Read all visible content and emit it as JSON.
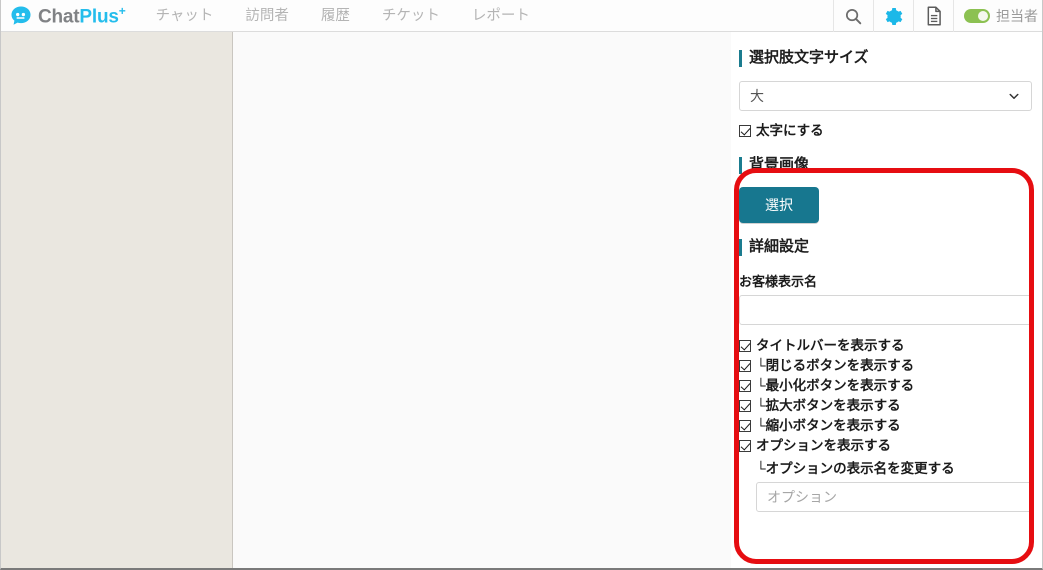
{
  "header": {
    "logo": {
      "icon": "chat-bubble-icon",
      "text_primary": "Chat",
      "text_secondary": "Plus",
      "superscript": "+"
    },
    "nav_items": [
      {
        "label": "チャット",
        "name": "nav-chat"
      },
      {
        "label": "訪問者",
        "name": "nav-visitors"
      },
      {
        "label": "履歴",
        "name": "nav-history"
      },
      {
        "label": "チケット",
        "name": "nav-tickets"
      },
      {
        "label": "レポート",
        "name": "nav-reports"
      }
    ],
    "actions": [
      {
        "icon": "search-icon",
        "name": "search-button"
      },
      {
        "icon": "gear-icon",
        "name": "settings-button"
      },
      {
        "icon": "document-icon",
        "name": "document-button"
      }
    ],
    "toggle": {
      "label": "担当者",
      "state": "on",
      "on_color": "#8cc152"
    }
  },
  "settings": {
    "font_size_section": {
      "title": "選択肢文字サイズ",
      "select_value": "大",
      "select_options": [
        "大"
      ],
      "bold_checkbox": {
        "label": "太字にする",
        "checked": true
      }
    },
    "background_section": {
      "title": "背景画像",
      "select_button_label": "選択"
    },
    "detail_section": {
      "title": "詳細設定",
      "display_name_label": "お客様表示名",
      "display_name_value": "",
      "display_name_placeholder": "",
      "checkboxes": [
        {
          "label": "タイトルバーを表示する",
          "checked": true,
          "name": "checkbox-show-titlebar"
        },
        {
          "label": "└閉じるボタンを表示する",
          "checked": true,
          "name": "checkbox-show-close-button"
        },
        {
          "label": "└最小化ボタンを表示する",
          "checked": true,
          "name": "checkbox-show-minimize-button"
        },
        {
          "label": "└拡大ボタンを表示する",
          "checked": true,
          "name": "checkbox-show-maximize-button"
        },
        {
          "label": "└縮小ボタンを表示する",
          "checked": true,
          "name": "checkbox-show-shrink-button"
        },
        {
          "label": "オプションを表示する",
          "checked": true,
          "name": "checkbox-show-options"
        }
      ],
      "option_rename_note": "└オプションの表示名を変更する",
      "option_name_value": "",
      "option_name_placeholder": "オプション"
    }
  },
  "annotation": {
    "highlight_color": "#e60d11",
    "shape": "rounded-rectangle"
  },
  "colors": {
    "accent_teal": "#1b7c8f",
    "button_teal": "#17778f",
    "logo_cyan": "#24bdec",
    "sidebar_bg": "#eae7e0"
  }
}
